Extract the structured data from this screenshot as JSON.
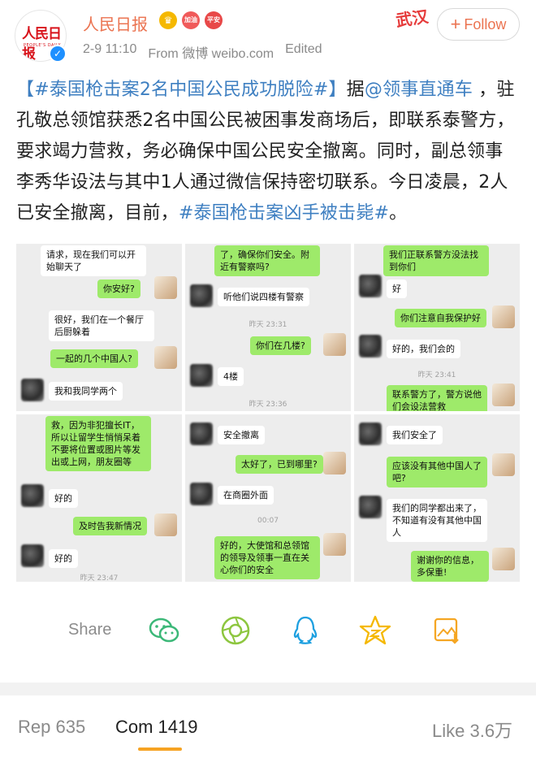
{
  "header": {
    "account_name": "人民日报",
    "avatar_logo_text": "人民日报",
    "avatar_logo_sub": "PEOPLE'S DAILY",
    "badges": [
      "加油",
      "平安"
    ],
    "timestamp": "2-9 11:10",
    "source": "From 微博 weibo.com",
    "edited": "Edited",
    "sticker_text": "武汉",
    "follow_label": "Follow"
  },
  "post": {
    "tag1": "【#泰国枪击案2名中国公民成功脱险#】",
    "text1": "据",
    "mention": "@领事直通车",
    "text2": " ，驻孔敬总领馆获悉2名中国公民被困事发商场后，即联系泰警方，要求竭力营救，务必确保中国公民安全撤离。同时，副总领事李秀华设法与其中1人通过微信保持密切联系。今日凌晨，2人已安全撤离，目前，",
    "tag2": "#泰国枪击案凶手被击毙#",
    "text3": "。"
  },
  "chat_screens": [
    {
      "messages": [
        {
          "side": "in",
          "text": "请求，现在我们可以开始聊天了"
        },
        {
          "side": "out",
          "text": "你安好?"
        },
        {
          "side": "in",
          "text": "很好，我们在一个餐厅后厨躲着"
        },
        {
          "side": "out",
          "text": "一起的几个中国人?"
        },
        {
          "side": "in",
          "text": "我和我同学两个"
        }
      ]
    },
    {
      "messages": [
        {
          "side": "out",
          "text": "了，确保你们安全。附近有警察吗?"
        },
        {
          "side": "in",
          "text": "听他们说四楼有警察"
        },
        {
          "side": "ts",
          "text": "昨天 23:31"
        },
        {
          "side": "out",
          "text": "你们在几楼?"
        },
        {
          "side": "in",
          "text": "4楼"
        },
        {
          "side": "ts",
          "text": "昨天 23:36"
        }
      ]
    },
    {
      "messages": [
        {
          "side": "out",
          "text": "我们正联系警方没法找到你们"
        },
        {
          "side": "in",
          "text": "好"
        },
        {
          "side": "out",
          "text": "你们注意自我保护好"
        },
        {
          "side": "in",
          "text": "好的，我们会的"
        },
        {
          "side": "ts",
          "text": "昨天 23:41"
        },
        {
          "side": "out",
          "text": "联系警方了，警方说他们会设法营救"
        }
      ]
    },
    {
      "messages": [
        {
          "side": "out",
          "text": "救，因为非犯擅长IT，所以让留学生悄悄呆着不要将位置或图片等发出或上网，朋友圈等"
        },
        {
          "side": "in",
          "text": "好的"
        },
        {
          "side": "out",
          "text": "及时告我新情况"
        },
        {
          "side": "in",
          "text": "好的"
        },
        {
          "side": "ts",
          "text": "昨天 23:47"
        }
      ]
    },
    {
      "messages": [
        {
          "side": "in",
          "text": "安全撤离"
        },
        {
          "side": "out",
          "text": "太好了，已到哪里?"
        },
        {
          "side": "in",
          "text": "在商圈外面"
        },
        {
          "side": "ts",
          "text": "00:07"
        },
        {
          "side": "out",
          "text": "好的，大使馆和总领馆的领导及领事一直在关心你们的安全"
        }
      ]
    },
    {
      "messages": [
        {
          "side": "in",
          "text": "我们安全了"
        },
        {
          "side": "out",
          "text": "应该没有其他中国人了吧?"
        },
        {
          "side": "in",
          "text": "我们的同学都出来了，不知道有没有其他中国人"
        },
        {
          "side": "out",
          "text": "谢谢你的信息，多保重!"
        }
      ]
    }
  ],
  "share_bar": {
    "label": "Share",
    "icons": [
      "wechat-icon",
      "moments-icon",
      "qq-icon",
      "qzone-icon",
      "save-image-icon"
    ]
  },
  "tabs": {
    "reposts": "Rep 635",
    "comments": "Com 1419",
    "likes": "Like 3.6万"
  },
  "colors": {
    "accent": "#eb7350",
    "link": "#3e7fc1",
    "chat_out": "#9eea6a",
    "tab_underline": "#f6a323"
  }
}
